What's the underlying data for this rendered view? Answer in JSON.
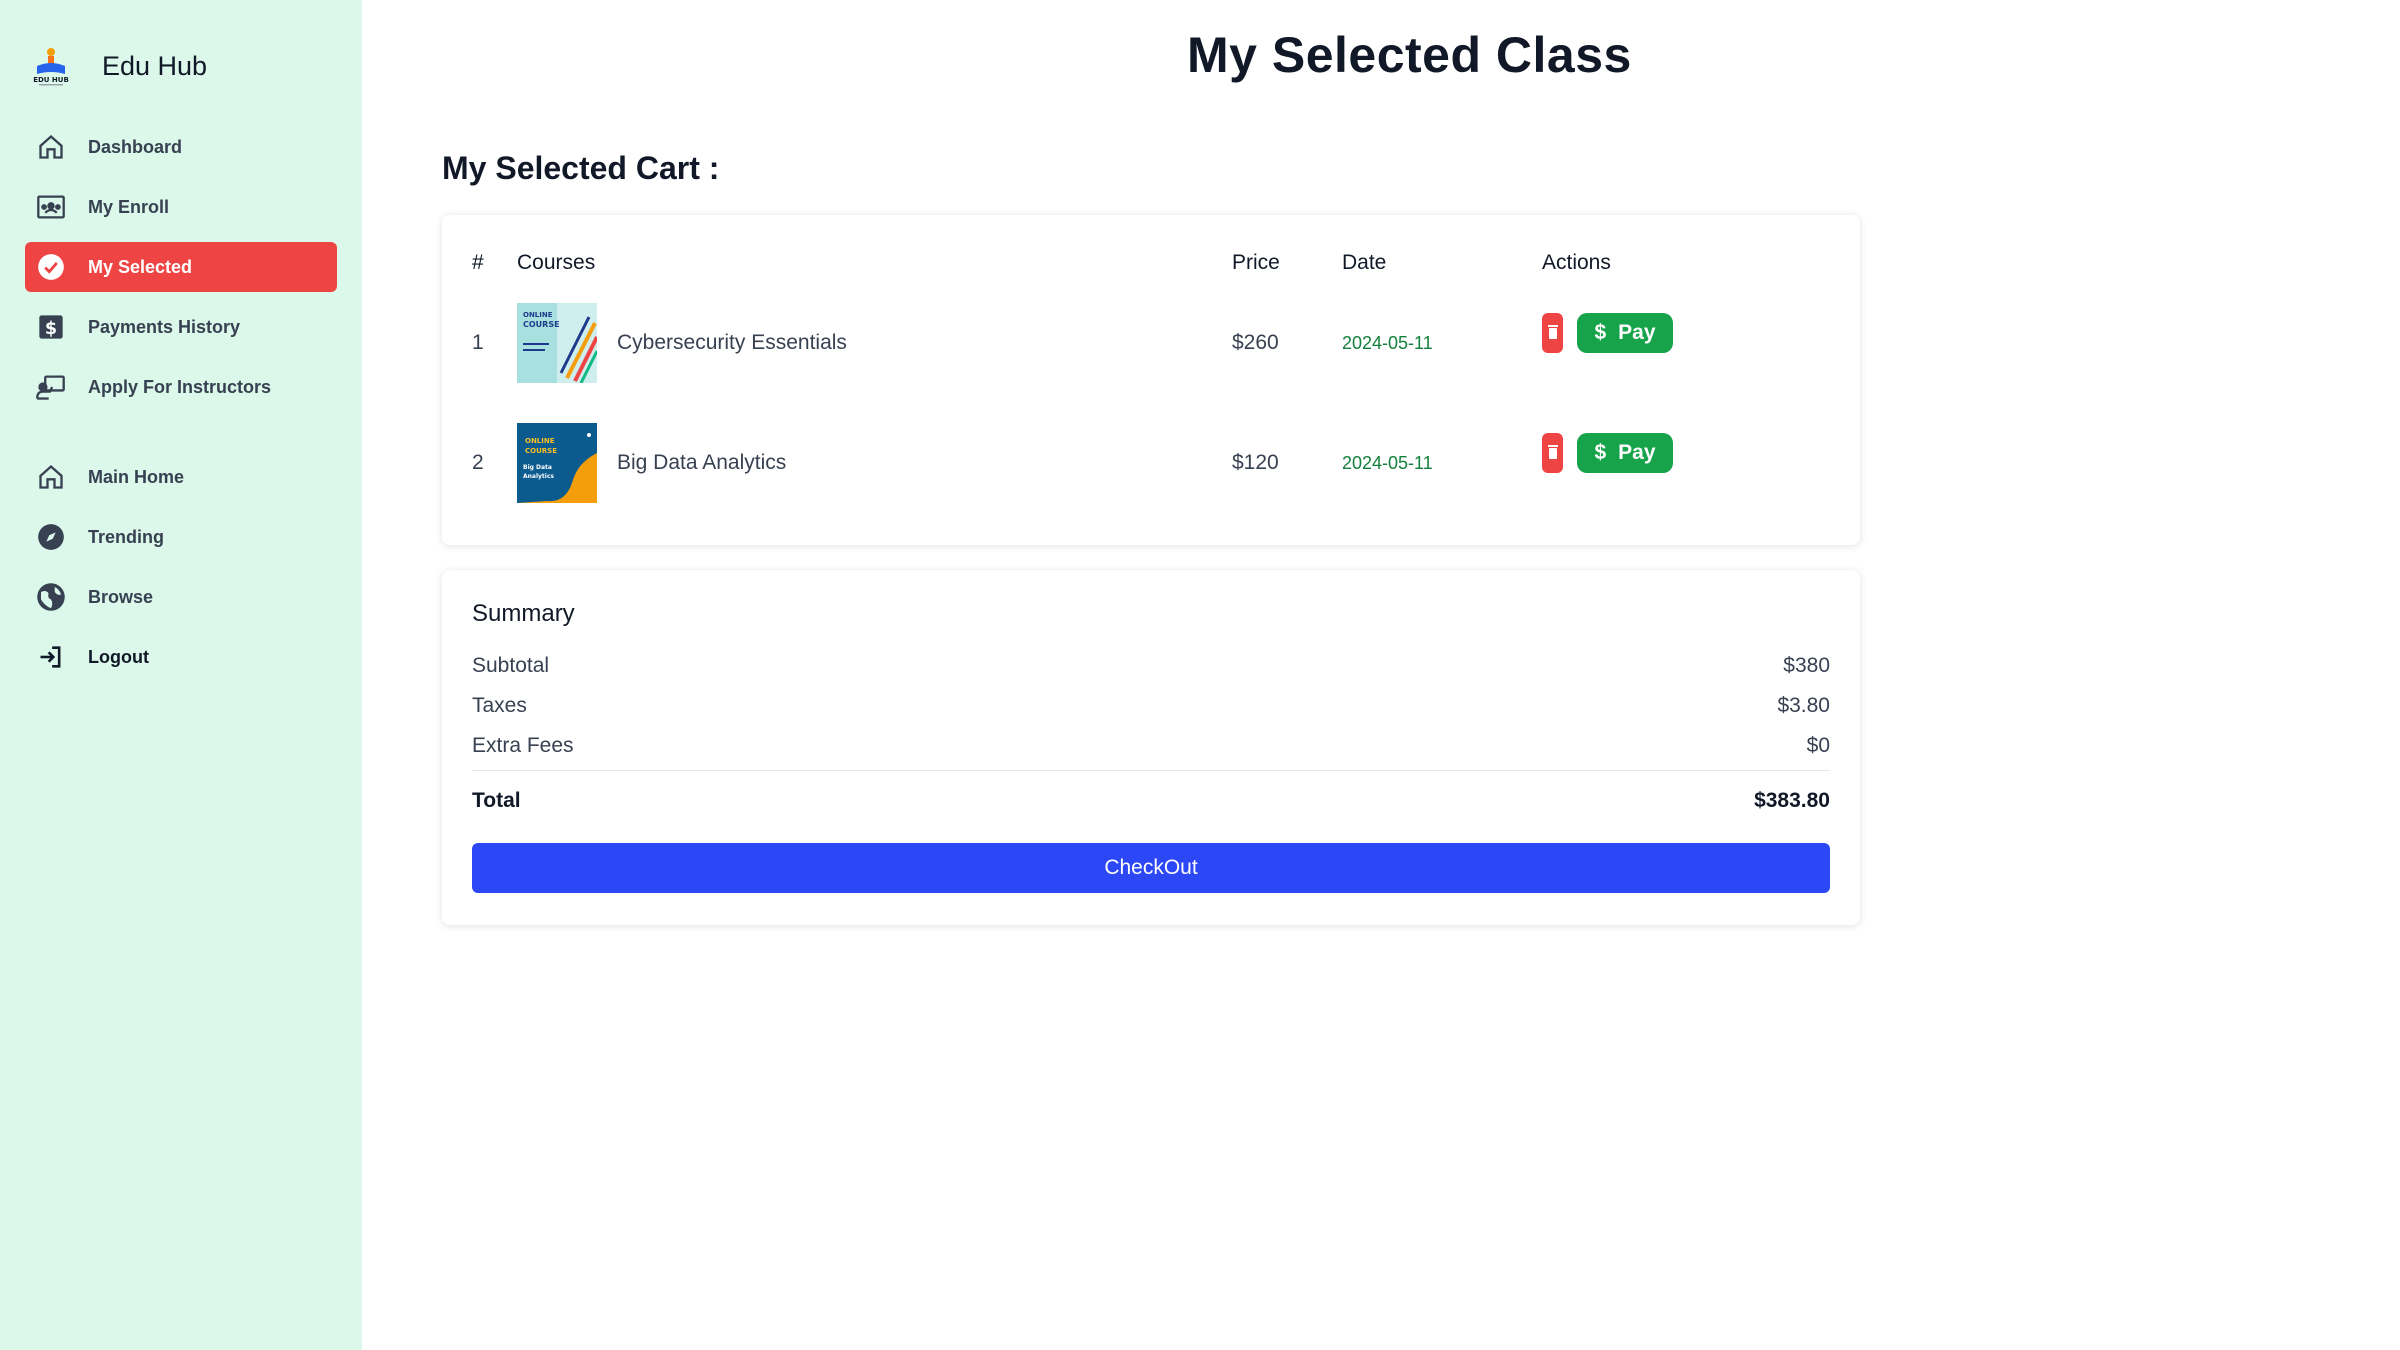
{
  "brand": {
    "title": "Edu Hub"
  },
  "sidebar": {
    "items": [
      {
        "label": "Dashboard",
        "icon": "home-icon"
      },
      {
        "label": "My Enroll",
        "icon": "enroll-icon"
      },
      {
        "label": "My Selected",
        "icon": "check-circle-icon",
        "active": true
      },
      {
        "label": "Payments History",
        "icon": "dollar-icon"
      },
      {
        "label": "Apply For Instructors",
        "icon": "instructor-icon"
      }
    ],
    "secondary": [
      {
        "label": "Main Home",
        "icon": "home-icon"
      },
      {
        "label": "Trending",
        "icon": "compass-icon"
      },
      {
        "label": "Browse",
        "icon": "globe-icon"
      },
      {
        "label": "Logout",
        "icon": "logout-icon"
      }
    ]
  },
  "page": {
    "title": "My Selected Class",
    "cart_heading": "My Selected Cart :"
  },
  "table": {
    "headers": [
      "#",
      "Courses",
      "Price",
      "Date",
      "Actions"
    ],
    "rows": [
      {
        "index": "1",
        "course": "Cybersecurity Essentials",
        "price": "$260",
        "date": "2024-05-11",
        "pay": "Pay"
      },
      {
        "index": "2",
        "course": "Big Data Analytics",
        "price": "$120",
        "date": "2024-05-11",
        "pay": "Pay"
      }
    ]
  },
  "summary": {
    "title": "Summary",
    "subtotal_label": "Subtotal",
    "subtotal": "$380",
    "taxes_label": "Taxes",
    "taxes": "$3.80",
    "fees_label": "Extra Fees",
    "fees": "$0",
    "total_label": "Total",
    "total": "$383.80",
    "checkout": "CheckOut"
  },
  "colors": {
    "sidebar_bg": "#dbf8ea",
    "active": "#ef4444",
    "pay": "#16a34a",
    "checkout": "#2c47f5",
    "date": "#15803d"
  }
}
